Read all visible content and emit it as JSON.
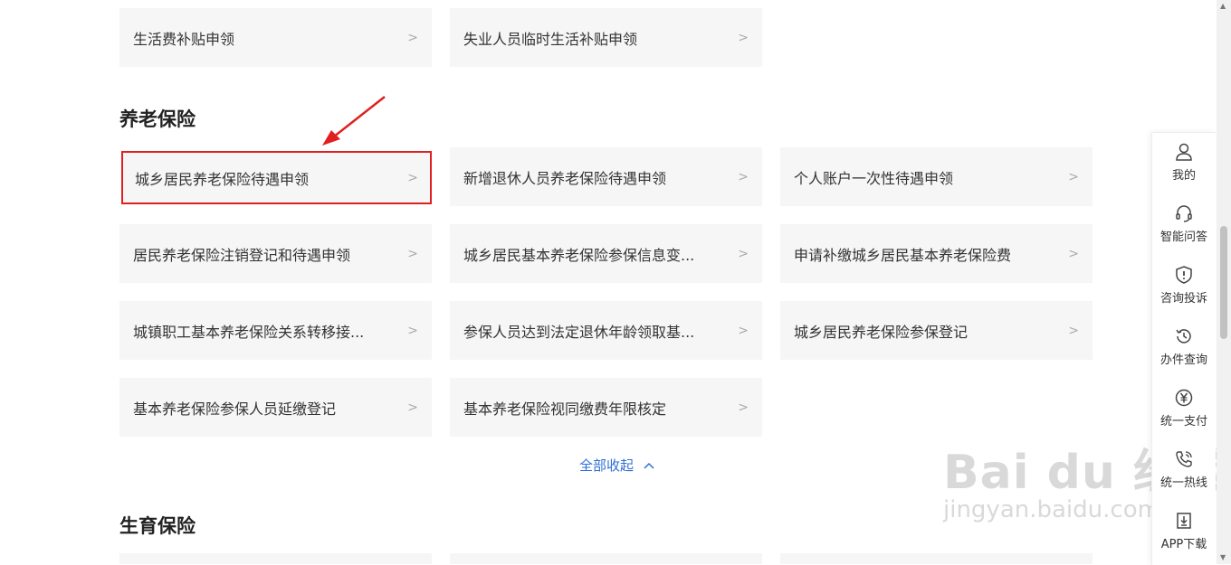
{
  "top_cards": [
    {
      "label": "生活费补贴申领"
    },
    {
      "label": "失业人员临时生活补贴申领"
    }
  ],
  "pension_section": {
    "title": "养老保险",
    "cards": [
      {
        "label": "城乡居民养老保险待遇申领"
      },
      {
        "label": "新增退休人员养老保险待遇申领"
      },
      {
        "label": "个人账户一次性待遇申领"
      },
      {
        "label": "居民养老保险注销登记和待遇申领"
      },
      {
        "label": "城乡居民基本养老保险参保信息变..."
      },
      {
        "label": "申请补缴城乡居民基本养老保险费"
      },
      {
        "label": "城镇职工基本养老保险关系转移接..."
      },
      {
        "label": "参保人员达到法定退休年龄领取基..."
      },
      {
        "label": "城乡居民养老保险参保登记"
      },
      {
        "label": "基本养老保险参保人员延缴登记"
      },
      {
        "label": "基本养老保险视同缴费年限核定"
      }
    ],
    "collapse_label": "全部收起"
  },
  "maternity_section": {
    "title": "生育保险"
  },
  "chevron": ">",
  "sidebar": {
    "items": [
      {
        "label": "我的",
        "icon": "user-icon"
      },
      {
        "label": "智能问答",
        "icon": "headset-icon"
      },
      {
        "label": "咨询投诉",
        "icon": "shield-alert-icon"
      },
      {
        "label": "办件查询",
        "icon": "history-icon"
      },
      {
        "label": "统一支付",
        "icon": "yen-icon"
      },
      {
        "label": "统一热线",
        "icon": "phone-icon"
      },
      {
        "label": "APP下载",
        "icon": "download-icon"
      }
    ]
  },
  "watermark": {
    "main": "Bai du 经验",
    "sub": "jingyan.baidu.com"
  },
  "colors": {
    "highlight": "#e02020",
    "link": "#2f6fd6",
    "card_bg": "#f6f6f6"
  }
}
